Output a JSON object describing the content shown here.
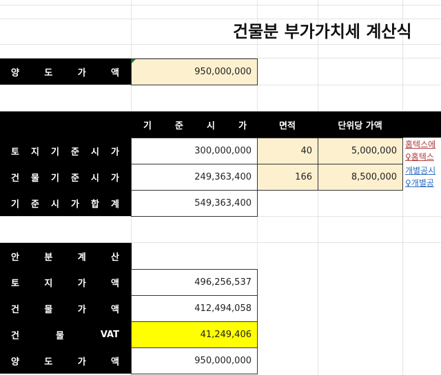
{
  "title": "건물분 부가가치세 계산식",
  "sale_price": {
    "label": [
      "양",
      "도",
      "가",
      "액"
    ],
    "value": "950,000,000"
  },
  "header": {
    "standard_price": [
      "기",
      "준",
      "시",
      "가"
    ],
    "area": "면적",
    "unit_price": "단위당 가액"
  },
  "land_standard": {
    "label": [
      "토",
      "지",
      "기",
      "준",
      "시",
      "가"
    ],
    "value": "300,000,000",
    "area": "40",
    "unit_price": "5,000,000",
    "link1": "홈텍스에",
    "link2": "♀홈텍스"
  },
  "building_standard": {
    "label": [
      "건",
      "물",
      "기",
      "준",
      "시",
      "가"
    ],
    "value": "249,363,400",
    "area": "166",
    "unit_price": "8,500,000",
    "link1": "개별공시",
    "link2": "♀개별공"
  },
  "standard_total": {
    "label": [
      "기",
      "준",
      "시",
      "가",
      "합",
      "계"
    ],
    "value": "549,363,400"
  },
  "allocation": {
    "label": [
      "안",
      "분",
      "계",
      "산"
    ]
  },
  "land_value": {
    "label": [
      "토",
      "지",
      "가",
      "액"
    ],
    "value": "496,256,537"
  },
  "building_value": {
    "label": [
      "건",
      "물",
      "가",
      "액"
    ],
    "value": "412,494,058"
  },
  "building_vat": {
    "label": [
      "건",
      "물",
      "VAT"
    ],
    "value": "41,249,406"
  },
  "sale_price_2": {
    "label": [
      "양",
      "도",
      "가",
      "액"
    ],
    "value": "950,000,000"
  },
  "colors": {
    "cream": "#fdf0cf",
    "highlight": "#ffff00",
    "header_bg": "#000000"
  }
}
